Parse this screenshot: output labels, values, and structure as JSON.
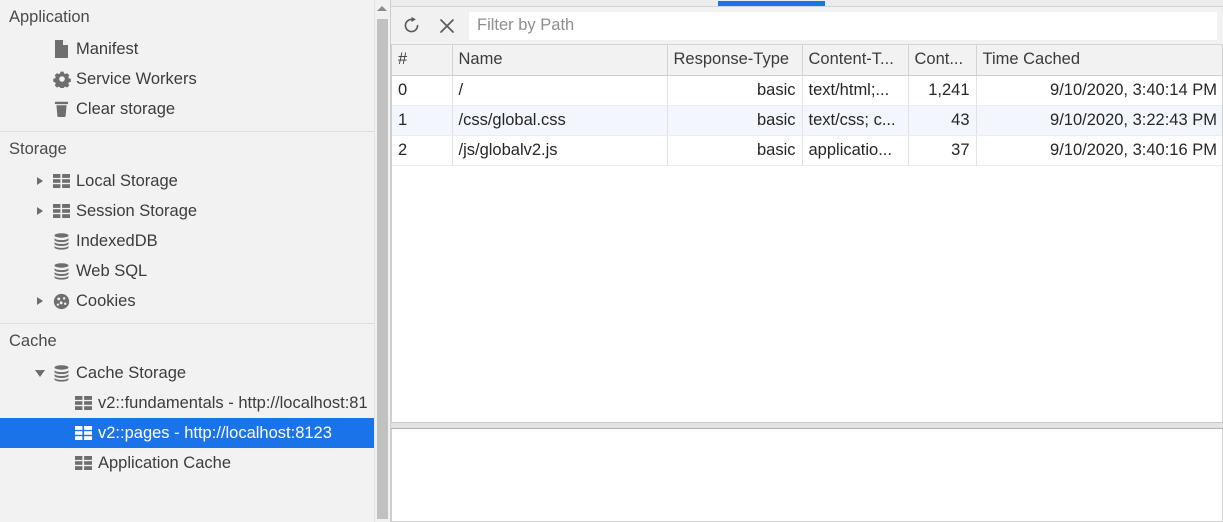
{
  "sidebar": {
    "sections": [
      {
        "title": "Application",
        "items": [
          {
            "label": "Manifest",
            "icon": "document-icon",
            "indent": 2,
            "arrow": "none",
            "selected": false
          },
          {
            "label": "Service Workers",
            "icon": "gear-icon",
            "indent": 2,
            "arrow": "none",
            "selected": false
          },
          {
            "label": "Clear storage",
            "icon": "trash-icon",
            "indent": 2,
            "arrow": "none",
            "selected": false
          }
        ]
      },
      {
        "title": "Storage",
        "items": [
          {
            "label": "Local Storage",
            "icon": "table-icon",
            "indent": 2,
            "arrow": "collapsed",
            "selected": false
          },
          {
            "label": "Session Storage",
            "icon": "table-icon",
            "indent": 2,
            "arrow": "collapsed",
            "selected": false
          },
          {
            "label": "IndexedDB",
            "icon": "database-icon",
            "indent": 2,
            "arrow": "none",
            "selected": false
          },
          {
            "label": "Web SQL",
            "icon": "database-icon",
            "indent": 2,
            "arrow": "none",
            "selected": false
          },
          {
            "label": "Cookies",
            "icon": "cookie-icon",
            "indent": 2,
            "arrow": "collapsed",
            "selected": false
          }
        ]
      },
      {
        "title": "Cache",
        "items": [
          {
            "label": "Cache Storage",
            "icon": "database-icon",
            "indent": 2,
            "arrow": "expanded",
            "selected": false
          },
          {
            "label": "v2::fundamentals - http://localhost:81",
            "icon": "table-icon",
            "indent": 3,
            "arrow": "none",
            "selected": false
          },
          {
            "label": "v2::pages - http://localhost:8123",
            "icon": "table-icon",
            "indent": 3,
            "arrow": "none",
            "selected": true
          },
          {
            "label": "Application Cache",
            "icon": "table-icon",
            "indent": 3,
            "arrow": "none",
            "selected": false
          }
        ]
      }
    ]
  },
  "toolbar": {
    "refresh_label": "refresh-icon",
    "delete_label": "close-icon",
    "filter_placeholder": "Filter by Path",
    "filter_value": ""
  },
  "table": {
    "columns": [
      {
        "key": "index",
        "label": "#"
      },
      {
        "key": "name",
        "label": "Name"
      },
      {
        "key": "responseType",
        "label": "Response-Type"
      },
      {
        "key": "contentType",
        "label": "Content-T..."
      },
      {
        "key": "contentLen",
        "label": "Cont..."
      },
      {
        "key": "timeCached",
        "label": "Time Cached"
      }
    ],
    "rows": [
      {
        "index": "0",
        "name": "/",
        "responseType": "basic",
        "contentType": "text/html;...",
        "contentLen": "1,241",
        "timeCached": "9/10/2020, 3:40:14 PM"
      },
      {
        "index": "1",
        "name": "/css/global.css",
        "responseType": "basic",
        "contentType": "text/css; c...",
        "contentLen": "43",
        "timeCached": "9/10/2020, 3:22:43 PM"
      },
      {
        "index": "2",
        "name": "/js/globalv2.js",
        "responseType": "basic",
        "contentType": "applicatio...",
        "contentLen": "37",
        "timeCached": "9/10/2020, 3:40:16 PM"
      }
    ]
  },
  "colors": {
    "selection_blue": "#1a73e8",
    "tab_accent": "#1a73e8",
    "row_stripe": "#f3f7fd",
    "panel_bg": "#f2f2f2"
  }
}
